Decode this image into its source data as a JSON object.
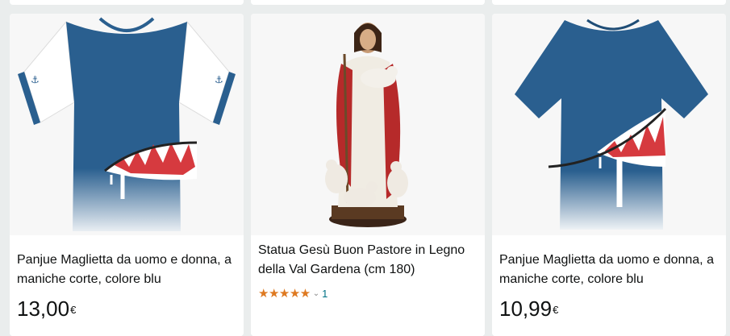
{
  "products": [
    {
      "title": "Panjue Maglietta da uomo e donna, a maniche corte, colore blu",
      "price_whole": "13,00",
      "currency": "€",
      "image": "shirt-blue-raglan-shark"
    },
    {
      "title": "Statua Gesù Buon Pastore in Legno della Val Gardena (cm 180)",
      "rating": 5,
      "stars": "★★★★★",
      "chevron": "⌄",
      "review_count": "1",
      "image": "jesus-good-shepherd-statue"
    },
    {
      "title": "Panjue Maglietta da uomo e donna, a maniche corte, colore blu",
      "price_whole": "10,99",
      "currency": "€",
      "image": "shirt-blue-shark"
    }
  ],
  "colors": {
    "accent_star": "#de7921",
    "link": "#007185",
    "shirt_blue": "#2a5f8f"
  }
}
